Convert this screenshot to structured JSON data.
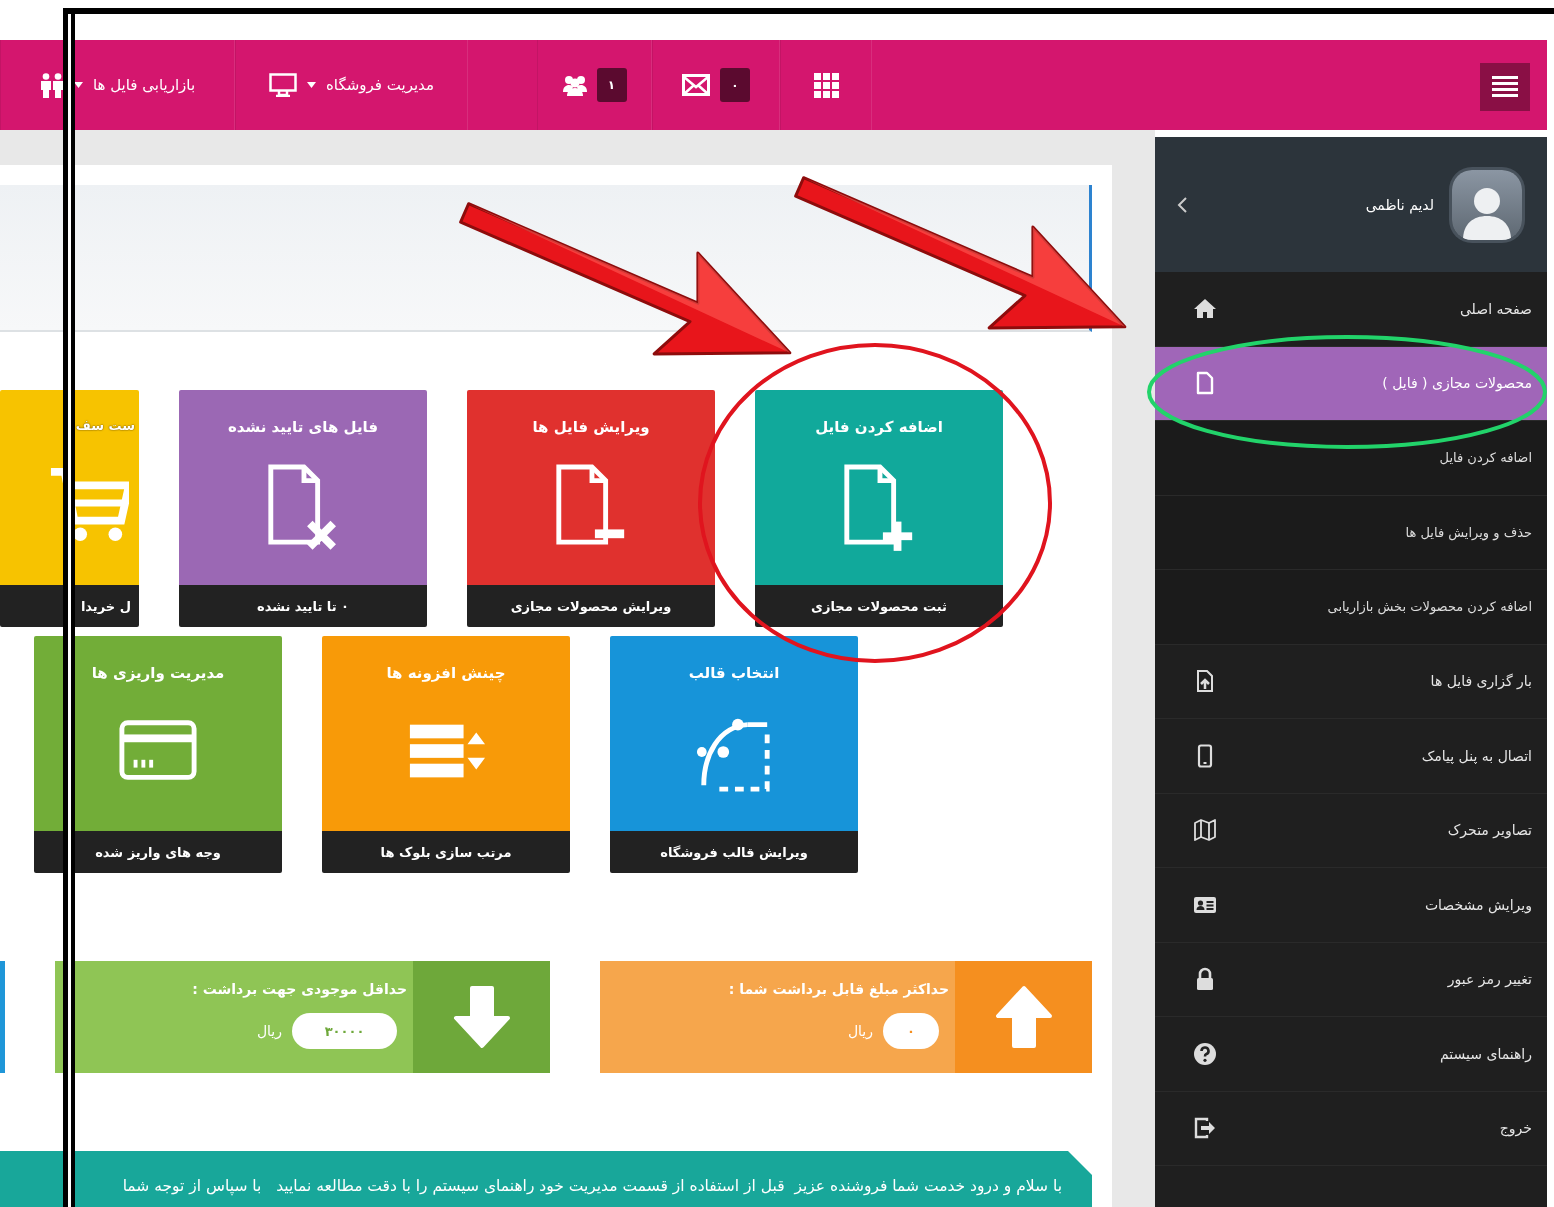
{
  "topbar": {
    "items": [
      {
        "kind": "apps"
      },
      {
        "kind": "mail",
        "badge": "۰"
      },
      {
        "kind": "users",
        "badge": "۱"
      },
      {
        "kind": "store",
        "label": "مدیریت فروشگاه"
      },
      {
        "kind": "marketing",
        "label": "بازاریابی فایل ها"
      }
    ]
  },
  "sidebar": {
    "user_name": "لدیم ناظمی",
    "items": [
      {
        "kind": "home",
        "label": "صفحه اصلی",
        "selected": false
      },
      {
        "kind": "file",
        "label": "محصولات مجازی ( فایل )",
        "selected": true
      },
      {
        "kind": "sub",
        "label": "اضافه کردن فایل",
        "selected": false
      },
      {
        "kind": "sub",
        "label": "حذف و ویرایش فایل ها",
        "selected": false
      },
      {
        "kind": "sub",
        "label": "اضافه کردن محصولات بخش بازاریابی",
        "selected": false
      },
      {
        "kind": "upload",
        "label": "بار گزاری فایل ها",
        "selected": false
      },
      {
        "kind": "phone",
        "label": "اتصال به پنل پیامک",
        "selected": false
      },
      {
        "kind": "map",
        "label": "تصاویر متحرک",
        "selected": false
      },
      {
        "kind": "card",
        "label": "ویرایش مشخصات",
        "selected": false
      },
      {
        "kind": "lock",
        "label": "تغییر رمز عبور",
        "selected": false
      },
      {
        "kind": "help",
        "label": "راهنمای سیستم",
        "selected": false
      },
      {
        "kind": "exit",
        "label": "خروج",
        "selected": false
      }
    ]
  },
  "tile_rows": [
    [
      {
        "kind": "add",
        "title": "اضافه کردن فایل",
        "footer": "ثبت محصولات مجازی",
        "color": "#11a99b"
      },
      {
        "kind": "remove",
        "title": "ویرایش فایل ها",
        "footer": "ویرایش محصولات مجازی",
        "color": "#e0312e"
      },
      {
        "kind": "reject",
        "title": "فایل های تایید نشده",
        "footer": "۰ تا تایید نشده",
        "color": "#9b68b4"
      },
      {
        "kind": "cart",
        "title": "ست سف",
        "footer": "ل خریدا",
        "color": "#f7c300"
      }
    ],
    [
      {
        "kind": "template",
        "title": "انتخاب قالب",
        "footer": "ویرایش قالب فروشگاه",
        "color": "#1794d9"
      },
      {
        "kind": "sort",
        "title": "چینش افزونه ها",
        "footer": "مرتب سازی بلوک ها",
        "color": "#f89a08"
      },
      {
        "kind": "payment",
        "title": "مدیریت واریزی ها",
        "footer": "وجه های واریز شده",
        "color": "#72ad38"
      }
    ]
  ],
  "stats": [
    {
      "kind": "up",
      "label": "حداکثر مبلغ قابل برداشت شما :",
      "amount": "۰",
      "unit": "ریال"
    },
    {
      "kind": "down",
      "label": "حداقل موجودی جهت برداشت :",
      "amount": "۳۰۰۰۰",
      "unit": "ریال"
    },
    {
      "kind": "info"
    }
  ],
  "notice": {
    "text": "با سلام و درود خدمت شما فروشنده عزیز  قبل از استفاده از قسمت مدیریت خود راهنمای سیستم را با دقت مطالعه نمایید   با سپاس از توجه شما"
  }
}
